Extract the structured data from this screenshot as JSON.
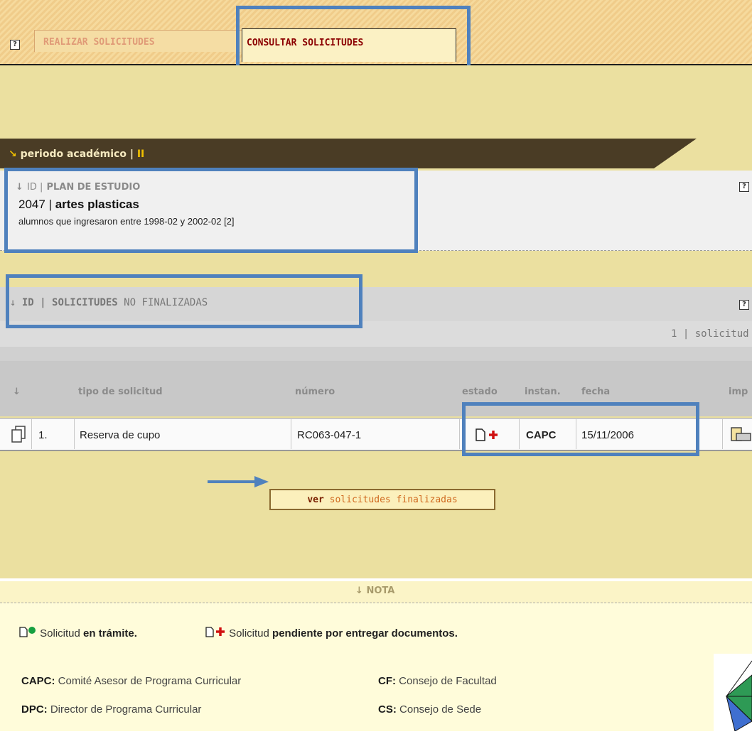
{
  "tabs": [
    {
      "label": "REALIZAR SOLICITUDES"
    },
    {
      "label": "CONSULTAR SOLICITUDES"
    }
  ],
  "periodo": {
    "label": "periodo académico |",
    "value": "II"
  },
  "plan": {
    "header_prefix": "ID |",
    "header": "PLAN DE ESTUDIO",
    "id": "2047 |",
    "name": "artes plasticas",
    "note": "alumnos que ingresaron entre 1998-02 y 2002-02 [2]"
  },
  "solicitudes": {
    "header_bold": "ID | SOLICITUDES",
    "header_rest": "NO FINALIZADAS",
    "count": "1 | solicitud"
  },
  "table": {
    "columns": [
      "tipo de solicitud",
      "número",
      "estado",
      "instan.",
      "fecha",
      "imp"
    ],
    "rows": [
      {
        "index": "1.",
        "tipo": "Reserva de cupo",
        "numero": "RC063-047-1",
        "instancia": "CAPC",
        "fecha": "15/11/2006"
      }
    ]
  },
  "button": {
    "bold": "ver",
    "rest": "solicitudes finalizadas"
  },
  "nota": {
    "title": "NOTA",
    "legend1_pre": "Solicitud",
    "legend1_bold": "en trámite.",
    "legend2_pre": "Solicitud",
    "legend2_bold": "pendiente por entregar documentos.",
    "defs": [
      {
        "abbr": "CAPC:",
        "text": "Comité Asesor de Programa Curricular"
      },
      {
        "abbr": "CF:",
        "text": "Consejo de Facultad"
      },
      {
        "abbr": "DPC:",
        "text": "Director de Programa Curricular"
      },
      {
        "abbr": "CS:",
        "text": "Consejo de Sede"
      }
    ]
  },
  "colors": {
    "highlight": "#4f81bd",
    "periodo_bg": "#4a3c25",
    "main_bg": "#ebe0a0"
  }
}
